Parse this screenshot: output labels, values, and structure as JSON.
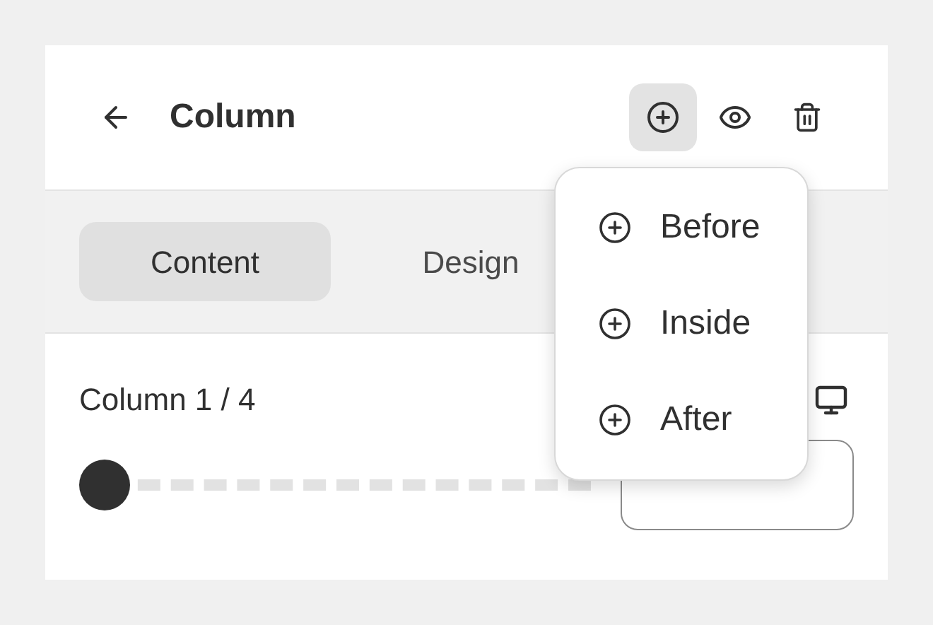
{
  "header": {
    "title": "Column",
    "add_selected": true
  },
  "tabs": [
    {
      "label": "Content",
      "selected": true
    },
    {
      "label": "Design",
      "selected": false
    }
  ],
  "menu": {
    "items": [
      "Before",
      "Inside",
      "After"
    ]
  },
  "column": {
    "label": "Column 1 / 4",
    "level": 0
  }
}
